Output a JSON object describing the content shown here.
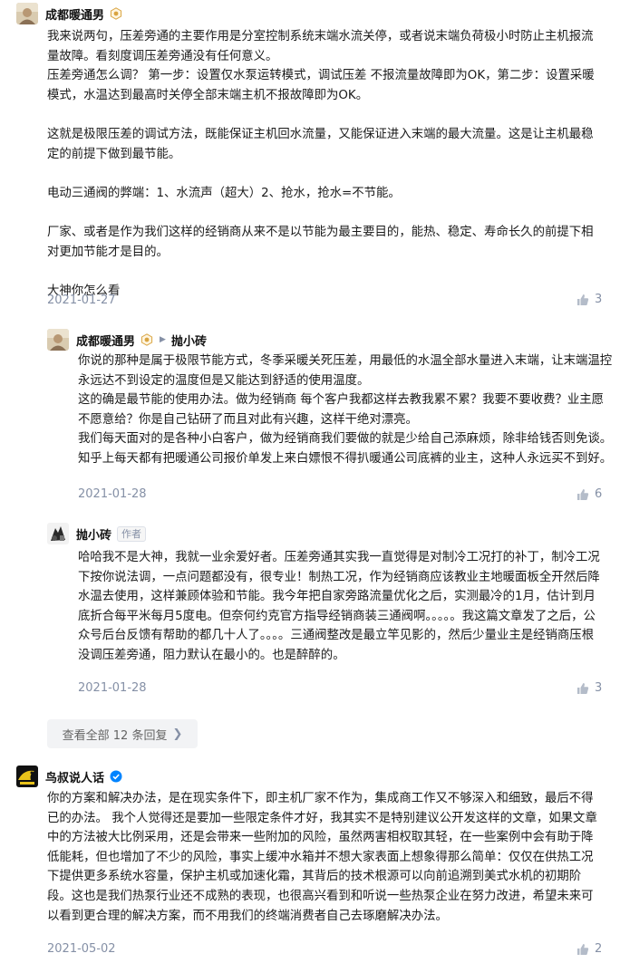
{
  "colors": {
    "text": "#121212",
    "meta": "#8590a6",
    "badge": "#0084ff",
    "button_bg": "#f2f3f5"
  },
  "comments": [
    {
      "author": "成都暖通男",
      "badge_icon": "creator-badge-icon",
      "paragraphs": [
        "我来说两句，压差旁通的主要作用是分室控制系统末端水流关停，或者说末端负荷极小时防止主机报流量故障。看刻度调压差旁通没有任何意义。",
        "压差旁通怎么调？ 第一步：设置仅水泵运转模式，调试压差 不报流量故障即为OK，第二步：设置采暖模式，水温达到最高时关停全部末端主机不报故障即为OK。",
        "",
        "这就是极限压差的调试方法，既能保证主机回水流量，又能保证进入末端的最大流量。这是让主机最稳定的前提下做到最节能。",
        "",
        "电动三通阀的弊端：1、水流声（超大）2、抢水，抢水=不节能。",
        "",
        "厂家、或者是作为我们这样的经销商从来不是以节能为最主要目的，能热、稳定、寿命长久的前提下相对更加节能才是目的。",
        "",
        "大神你怎么看"
      ],
      "date": "2021-01-27",
      "likes": "3"
    },
    {
      "author": "成都暖通男",
      "reply_to": "抛小砖",
      "paragraphs": [
        "你说的那种是属于极限节能方式，冬季采暖关死压差，用最低的水温全部水量进入末端，让末端温控永远达不到设定的温度但是又能达到舒适的使用温度。",
        "这的确是最节能的使用办法。做为经销商 每个客户我都这样去教我累不累？我要不要收费？业主愿不愿意给？你是自己钻研了而且对此有兴趣，这样干绝对漂亮。",
        "我们每天面对的是各种小白客户，做为经销商我们要做的就是少给自己添麻烦，除非给钱否则免谈。知乎上每天都有把暖通公司报价单发上来白嫖恨不得扒暖通公司底裤的业主，这种人永远买不到好。"
      ],
      "date": "2021-01-28",
      "likes": "6"
    },
    {
      "author": "抛小砖",
      "tag": "作者",
      "paragraphs": [
        "哈哈我不是大神，我就一业余爱好者。压差旁通其实我一直觉得是对制冷工况打的补丁，制冷工况下按你说法调，一点问题都没有，很专业！制热工况，作为经销商应该教业主地暖面板全开然后降水温去使用，这样兼顾体验和节能。我今年把自家旁路流量优化之后，实测最冷的1月，估计到月底折合每平米每月5度电。但奈何约克官方指导经销商装三通阀啊。。。。。我这篇文章发了之后，公众号后台反馈有帮助的都几十人了。。。。三通阀整改是最立竿见影的，然后少量业主是经销商压根没调压差旁通，阻力默认在最小的。也是醉醉的。"
      ],
      "date": "2021-01-28",
      "likes": "3"
    },
    {
      "author": "鸟叔说人话",
      "badge_icon": "verified-badge-icon",
      "paragraphs": [
        "你的方案和解决办法，是在现实条件下，即主机厂家不作为，集成商工作又不够深入和细致，最后不得已的办法。 我个人觉得还是要加一些限定条件才好，我其实不是特别建议公开发这样的文章，如果文章中的方法被大比例采用，还是会带来一些附加的风险，虽然两害相权取其轻，在一些案例中会有助于降低能耗，但也增加了不少的风险，事实上缓冲水箱并不想大家表面上想象得那么简单：仅仅在供热工况下提供更多系统水容量，保护主机或加速化霜，其背后的技术根源可以向前追溯到美式水机的初期阶段。这也是我们热泵行业还不成熟的表现，也很高兴看到和听说一些热泵企业在努力改进，希望未来可以看到更合理的解决方案，而不用我们的终端消费者自己去琢磨解决办法。"
      ],
      "date": "2021-05-02",
      "likes": "2"
    }
  ],
  "view_all": {
    "label": "查看全部 12 条回复",
    "chevron_icon": "chevron-right-icon"
  }
}
